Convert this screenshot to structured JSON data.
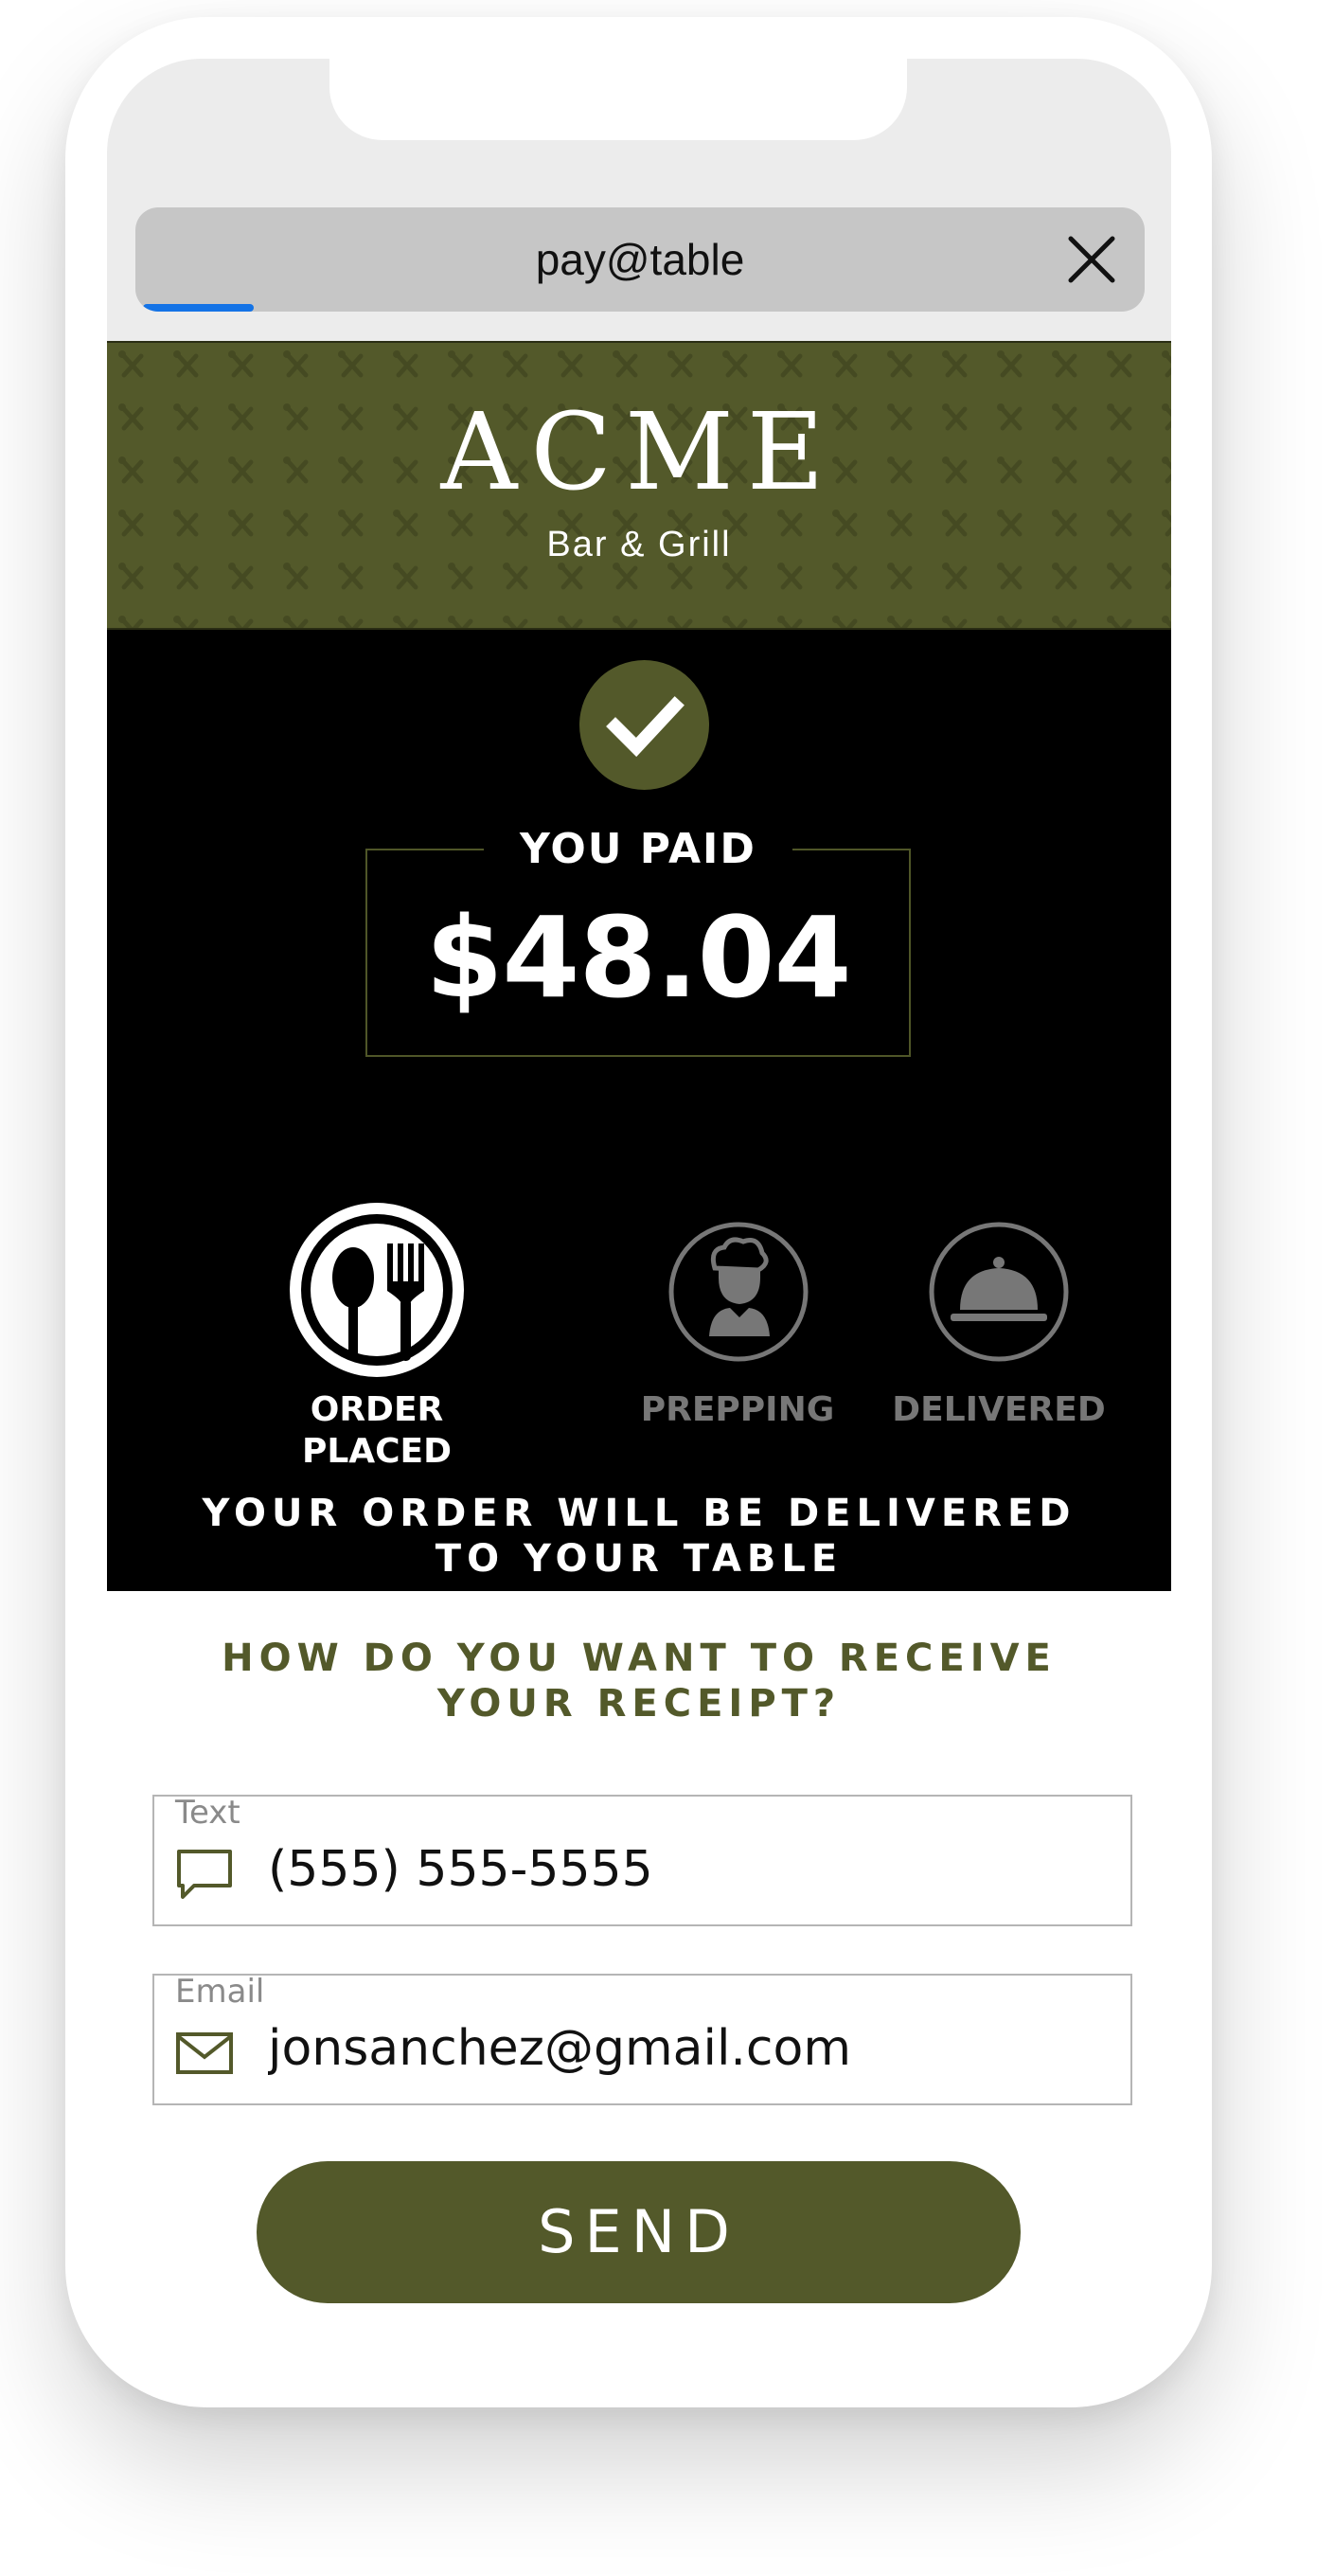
{
  "browser": {
    "url_title": "pay@table",
    "close_icon": "close-icon",
    "load_progress": 0.11
  },
  "restaurant": {
    "name": "ACME",
    "subtitle": "Bar & Grill"
  },
  "payment": {
    "status_icon": "checkmark-icon",
    "label": "YOU PAID",
    "amount": "$48.04"
  },
  "order_status": {
    "steps": [
      {
        "label_line1": "ORDER",
        "label_line2": "PLACED",
        "icon": "utensils-icon",
        "active": true
      },
      {
        "label_line1": "PREPPING",
        "label_line2": "",
        "icon": "chef-icon",
        "active": false
      },
      {
        "label_line1": "DELIVERED",
        "label_line2": "",
        "icon": "cloche-icon",
        "active": false
      }
    ],
    "message_line1": "YOUR ORDER WILL BE DELIVERED",
    "message_line2": "TO YOUR TABLE"
  },
  "receipt": {
    "question_line1": "HOW DO YOU WANT TO RECEIVE",
    "question_line2": "YOUR RECEIPT?",
    "text_field": {
      "label": "Text",
      "value": "(555) 555-5555",
      "icon": "chat-bubble-icon"
    },
    "email_field": {
      "label": "Email",
      "value": "jonsanchez@gmail.com",
      "icon": "envelope-icon"
    },
    "send_label": "SEND"
  },
  "colors": {
    "brand_olive": "#53592a",
    "progress_blue": "#1473e6",
    "inactive_gray": "#777777",
    "background_dark": "#000000"
  }
}
